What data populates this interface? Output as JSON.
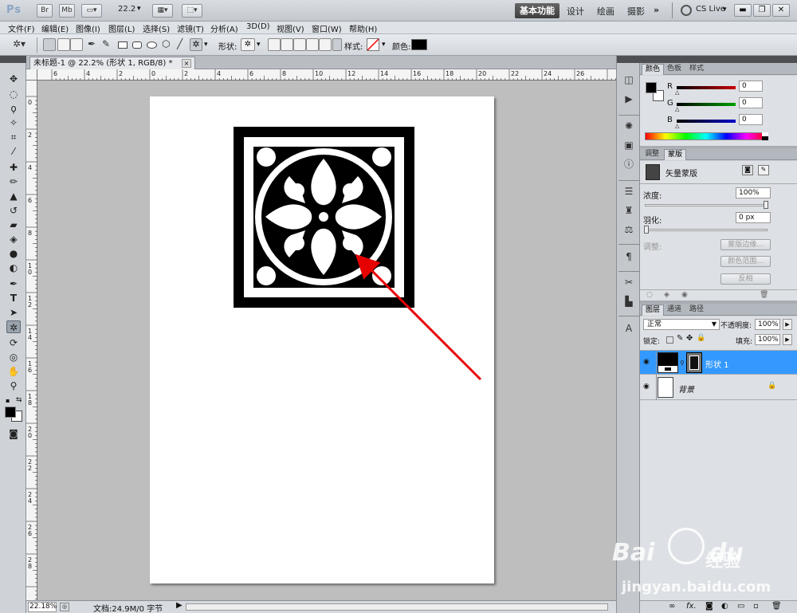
{
  "appbar": {
    "logo": "Ps",
    "bridge_button": "Br",
    "minibridge_button": "Mb",
    "zoom_value": "22.2",
    "workspace_active": "基本功能",
    "workspaces": [
      "设计",
      "绘画",
      "摄影"
    ],
    "more": "»",
    "cslive": "CS Live"
  },
  "menus": [
    "文件(F)",
    "编辑(E)",
    "图像(I)",
    "图层(L)",
    "选择(S)",
    "滤镜(T)",
    "分析(A)",
    "3D(D)",
    "视图(V)",
    "窗口(W)",
    "帮助(H)"
  ],
  "options": {
    "shape_label": "形状:",
    "style_label": "样式:",
    "color_label": "颜色:",
    "color_swatch": "#000000"
  },
  "document": {
    "tab_title": "未标题-1 @ 22.2% (形状 1, RGB/8) *",
    "tab_close": "×",
    "ruler_h_numbers": [
      "6",
      "4",
      "2",
      "0",
      "2",
      "4",
      "6",
      "8",
      "10",
      "12",
      "14",
      "16",
      "18",
      "20",
      "22",
      "24",
      "26"
    ],
    "ruler_v_numbers": [
      "0",
      "2",
      "4",
      "6",
      "8",
      "1 0",
      "1 2",
      "1 4",
      "1 6",
      "1 8",
      "2 0",
      "2 2",
      "2 4",
      "2 6",
      "2 8"
    ],
    "canvas_bg": "#bebebe",
    "artwork_color": "#000000",
    "annotation_color": "#e60000"
  },
  "status": {
    "zoom": "22.18%",
    "doc_info": "文档:24.9M/0 字节"
  },
  "color_panel": {
    "tabs": [
      "颜色",
      "色板",
      "样式"
    ],
    "channels": [
      {
        "label": "R",
        "value": "0",
        "color": "#c80000"
      },
      {
        "label": "G",
        "value": "0",
        "color": "#00a000"
      },
      {
        "label": "B",
        "value": "0",
        "color": "#0000c8"
      }
    ]
  },
  "masks_panel": {
    "tabs": [
      "调整",
      "蒙版"
    ],
    "title": "矢量蒙版",
    "density_label": "浓度:",
    "density_value": "100%",
    "feather_label": "羽化:",
    "feather_value": "0 px",
    "refine_label": "调整:",
    "mask_edge": "蒙版边缘...",
    "color_range": "颜色范围...",
    "invert": "反相"
  },
  "layers_panel": {
    "tabs": [
      "图层",
      "通道",
      "路径"
    ],
    "blend_mode": "正常",
    "opacity_label": "不透明度:",
    "opacity_value": "100%",
    "lock_label": "锁定:",
    "fill_label": "填充:",
    "fill_value": "100%",
    "layers": [
      {
        "name": "形状 1",
        "selected": true
      },
      {
        "name": "背景",
        "selected": false
      }
    ],
    "footer_icons": [
      "∞",
      "fx."
    ]
  },
  "watermark": {
    "brand": "Bai",
    "brand2": "du",
    "product": "经验",
    "url": "jingyan.baidu.com"
  }
}
